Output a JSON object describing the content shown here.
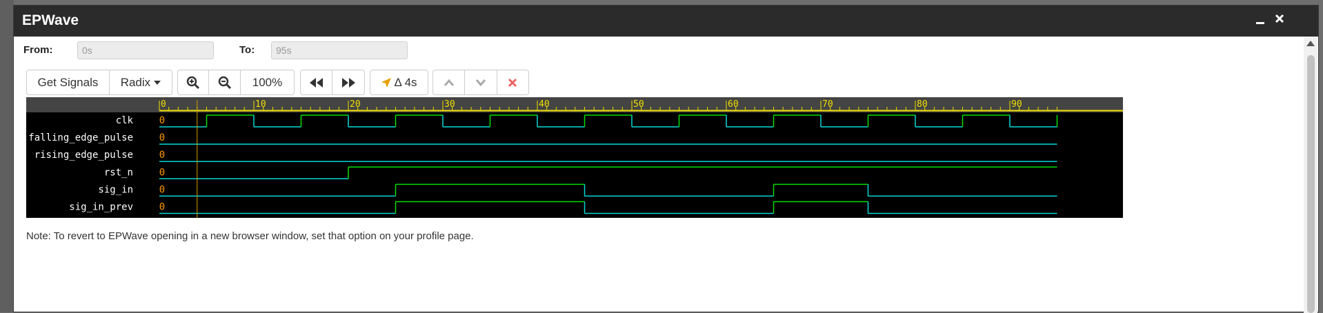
{
  "window": {
    "title": "EPWave",
    "minimize_icon": "minimize-icon",
    "close_icon": "close-icon"
  },
  "range": {
    "from_label": "From:",
    "from_value": "0s",
    "to_label": "To:",
    "to_value": "95s"
  },
  "toolbar": {
    "get_signals": "Get Signals",
    "radix": "Radix",
    "zoom_level": "100%",
    "delta": "Δ 4s",
    "icons": [
      "zoom-in-icon",
      "zoom-out-icon",
      "rewind-icon",
      "fast-forward-icon",
      "cursor-arrow-icon",
      "chevron-up-icon",
      "chevron-down-icon",
      "delete-x-icon"
    ]
  },
  "waveform": {
    "time_range": [
      0,
      95
    ],
    "cursor_time": 4,
    "tick_labels": [
      "0",
      "10",
      "20",
      "30",
      "40",
      "50",
      "60",
      "70",
      "80",
      "90"
    ],
    "colors": {
      "high": "#00e000",
      "low": "#00d8d8",
      "ruler": "#f0e000",
      "cursor": "#d4a000",
      "value": "#ff9900"
    },
    "signals": [
      {
        "name": "clk",
        "value": "0",
        "transitions": [
          [
            0,
            0
          ],
          [
            5,
            1
          ],
          [
            10,
            0
          ],
          [
            15,
            1
          ],
          [
            20,
            0
          ],
          [
            25,
            1
          ],
          [
            30,
            0
          ],
          [
            35,
            1
          ],
          [
            40,
            0
          ],
          [
            45,
            1
          ],
          [
            50,
            0
          ],
          [
            55,
            1
          ],
          [
            60,
            0
          ],
          [
            65,
            1
          ],
          [
            70,
            0
          ],
          [
            75,
            1
          ],
          [
            80,
            0
          ],
          [
            85,
            1
          ],
          [
            90,
            0
          ],
          [
            95,
            1
          ]
        ]
      },
      {
        "name": "falling_edge_pulse",
        "value": "0",
        "transitions": [
          [
            0,
            0
          ]
        ]
      },
      {
        "name": "rising_edge_pulse",
        "value": "0",
        "transitions": [
          [
            0,
            0
          ]
        ]
      },
      {
        "name": "rst_n",
        "value": "0",
        "transitions": [
          [
            0,
            0
          ],
          [
            20,
            1
          ]
        ]
      },
      {
        "name": "sig_in",
        "value": "0",
        "transitions": [
          [
            0,
            0
          ],
          [
            25,
            1
          ],
          [
            45,
            0
          ],
          [
            65,
            1
          ],
          [
            75,
            0
          ]
        ]
      },
      {
        "name": "sig_in_prev",
        "value": "0",
        "transitions": [
          [
            0,
            0
          ],
          [
            25,
            1
          ],
          [
            45,
            0
          ],
          [
            65,
            1
          ],
          [
            75,
            0
          ]
        ]
      }
    ]
  },
  "note": "Note: To revert to EPWave opening in a new browser window, set that option on your profile page."
}
